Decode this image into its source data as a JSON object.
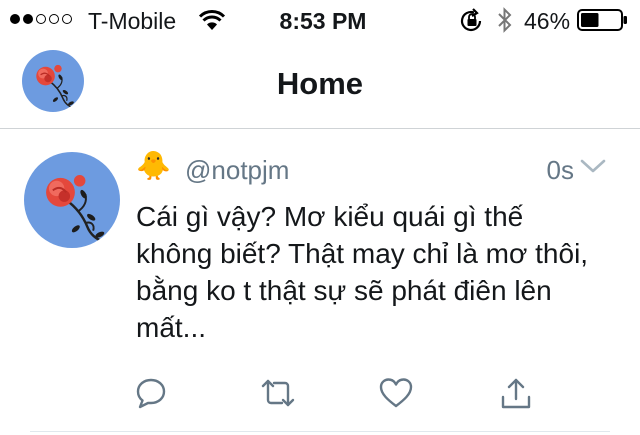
{
  "status_bar": {
    "carrier": "T-Mobile",
    "time": "8:53 PM",
    "battery": "46%",
    "signal_bars": 2,
    "signal_total": 5,
    "battery_level": 0.46
  },
  "nav": {
    "title": "Home"
  },
  "tweet": {
    "display_name": "🐥",
    "handle": "@notpjm",
    "timestamp": "0s",
    "text": "Cái gì vậy? Mơ kiểu quái gì thế không biết? Thật may chỉ là mơ thôi, bằng ko t thật sự sẽ phát điên lên mất...",
    "actions": [
      "reply-icon",
      "retweet-icon",
      "like-icon",
      "share-icon"
    ]
  },
  "colors": {
    "text": "#14171a",
    "secondary": "#657786",
    "avatar_bg": "#6d9be0",
    "rose": "#e4483c"
  }
}
